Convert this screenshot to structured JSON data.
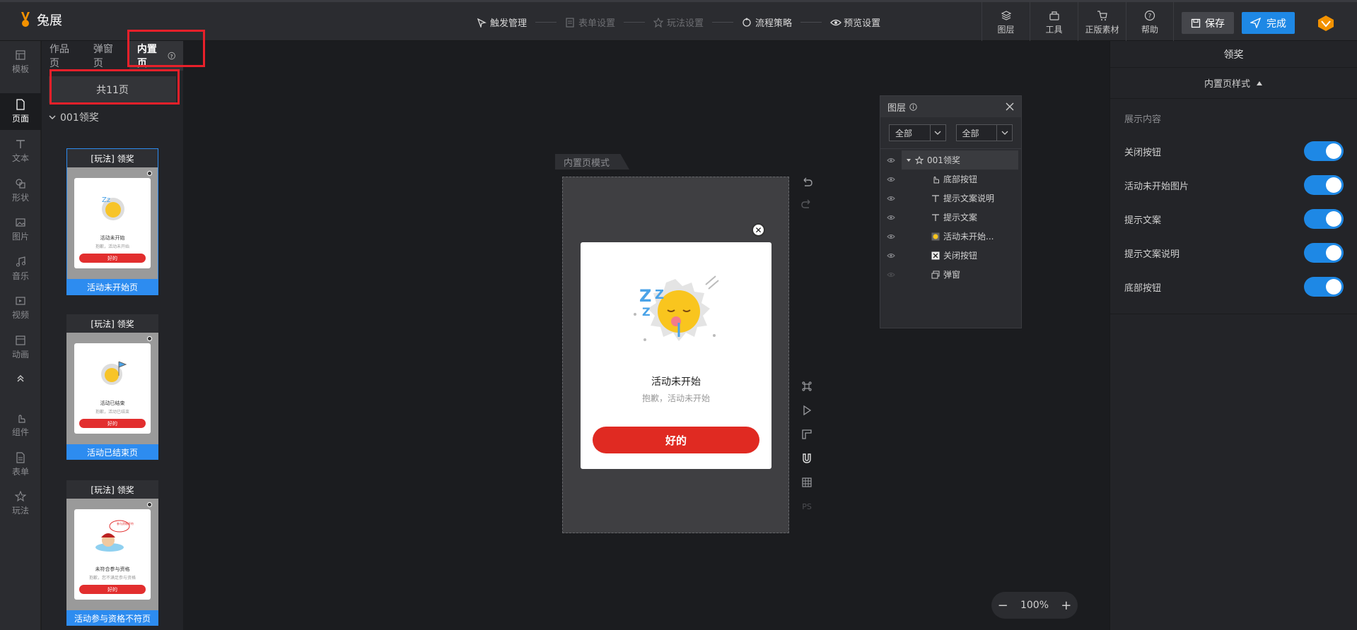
{
  "app": {
    "name": "兔展"
  },
  "steps": [
    {
      "label": "触发管理",
      "icon": "trigger-icon",
      "active": true
    },
    {
      "label": "表单设置",
      "icon": "form-icon",
      "active": false
    },
    {
      "label": "玩法设置",
      "icon": "gameplay-icon",
      "active": false
    },
    {
      "label": "流程策略",
      "icon": "flow-icon",
      "active": true
    },
    {
      "label": "预览设置",
      "icon": "eye-icon",
      "active": true
    }
  ],
  "tools": [
    {
      "label": "图层",
      "icon": "layers-icon"
    },
    {
      "label": "工具",
      "icon": "toolbox-icon"
    },
    {
      "label": "正版素材",
      "icon": "cart-icon"
    },
    {
      "label": "帮助",
      "icon": "help-icon"
    }
  ],
  "buttons": {
    "save": "保存",
    "done": "完成"
  },
  "leftnav": [
    {
      "label": "模板",
      "icon": "template-icon"
    },
    {
      "label": "页面",
      "icon": "page-icon"
    },
    {
      "label": "文本",
      "icon": "text-icon"
    },
    {
      "label": "形状",
      "icon": "shape-icon"
    },
    {
      "label": "图片",
      "icon": "image-icon"
    },
    {
      "label": "音乐",
      "icon": "music-icon"
    },
    {
      "label": "视频",
      "icon": "video-icon"
    },
    {
      "label": "动画",
      "icon": "animation-icon"
    },
    {
      "label": "组件",
      "icon": "component-icon"
    },
    {
      "label": "表单",
      "icon": "form-icon"
    },
    {
      "label": "玩法",
      "icon": "gameplay-icon"
    }
  ],
  "pages": {
    "tabs": [
      "作品页",
      "弹窗页",
      "内置页"
    ],
    "count_label": "共11页",
    "group": "001领奖",
    "thumbs": [
      {
        "head": "[玩法] 领奖",
        "title": "活动未开始",
        "sub": "抱歉，活动未开始",
        "btn": "好的",
        "foot": "活动未开始页"
      },
      {
        "head": "[玩法] 领奖",
        "title": "活动已结束",
        "sub": "抱歉，活动已结束",
        "btn": "好的",
        "foot": "活动已结束页"
      },
      {
        "head": "[玩法] 领奖",
        "title": "未符合参与资格",
        "sub": "抱歉，您不满足参与资格",
        "btn": "好的",
        "foot": "活动参与资格不符页",
        "bubble": "参与资格不符"
      }
    ]
  },
  "canvas": {
    "mode_label": "内置页模式",
    "popup": {
      "title": "活动未开始",
      "subtitle": "抱歉，活动未开始",
      "button": "好的"
    },
    "zoom": "100%",
    "ps_label": "PS"
  },
  "layers": {
    "title": "图层",
    "filter1": "全部",
    "filter2": "全部",
    "items": [
      {
        "label": "001领奖",
        "icon": "gameplay-icon"
      },
      {
        "label": "底部按钮",
        "icon": "hand-icon"
      },
      {
        "label": "提示文案说明",
        "icon": "text-icon"
      },
      {
        "label": "提示文案",
        "icon": "text-icon"
      },
      {
        "label": "活动未开始...",
        "icon": "image-thumb-icon"
      },
      {
        "label": "关闭按钮",
        "icon": "close-box-icon"
      },
      {
        "label": "弹窗",
        "icon": "popup-icon"
      }
    ]
  },
  "right": {
    "title": "领奖",
    "style_label": "内置页样式",
    "section": "展示内容",
    "toggles": [
      {
        "label": "关闭按钮",
        "on": true
      },
      {
        "label": "活动未开始图片",
        "on": true
      },
      {
        "label": "提示文案",
        "on": true
      },
      {
        "label": "提示文案说明",
        "on": true
      },
      {
        "label": "底部按钮",
        "on": true
      }
    ]
  },
  "colors": {
    "accent": "#1e88e5",
    "danger": "#e02a22",
    "highlight_box": "#e8202a"
  }
}
